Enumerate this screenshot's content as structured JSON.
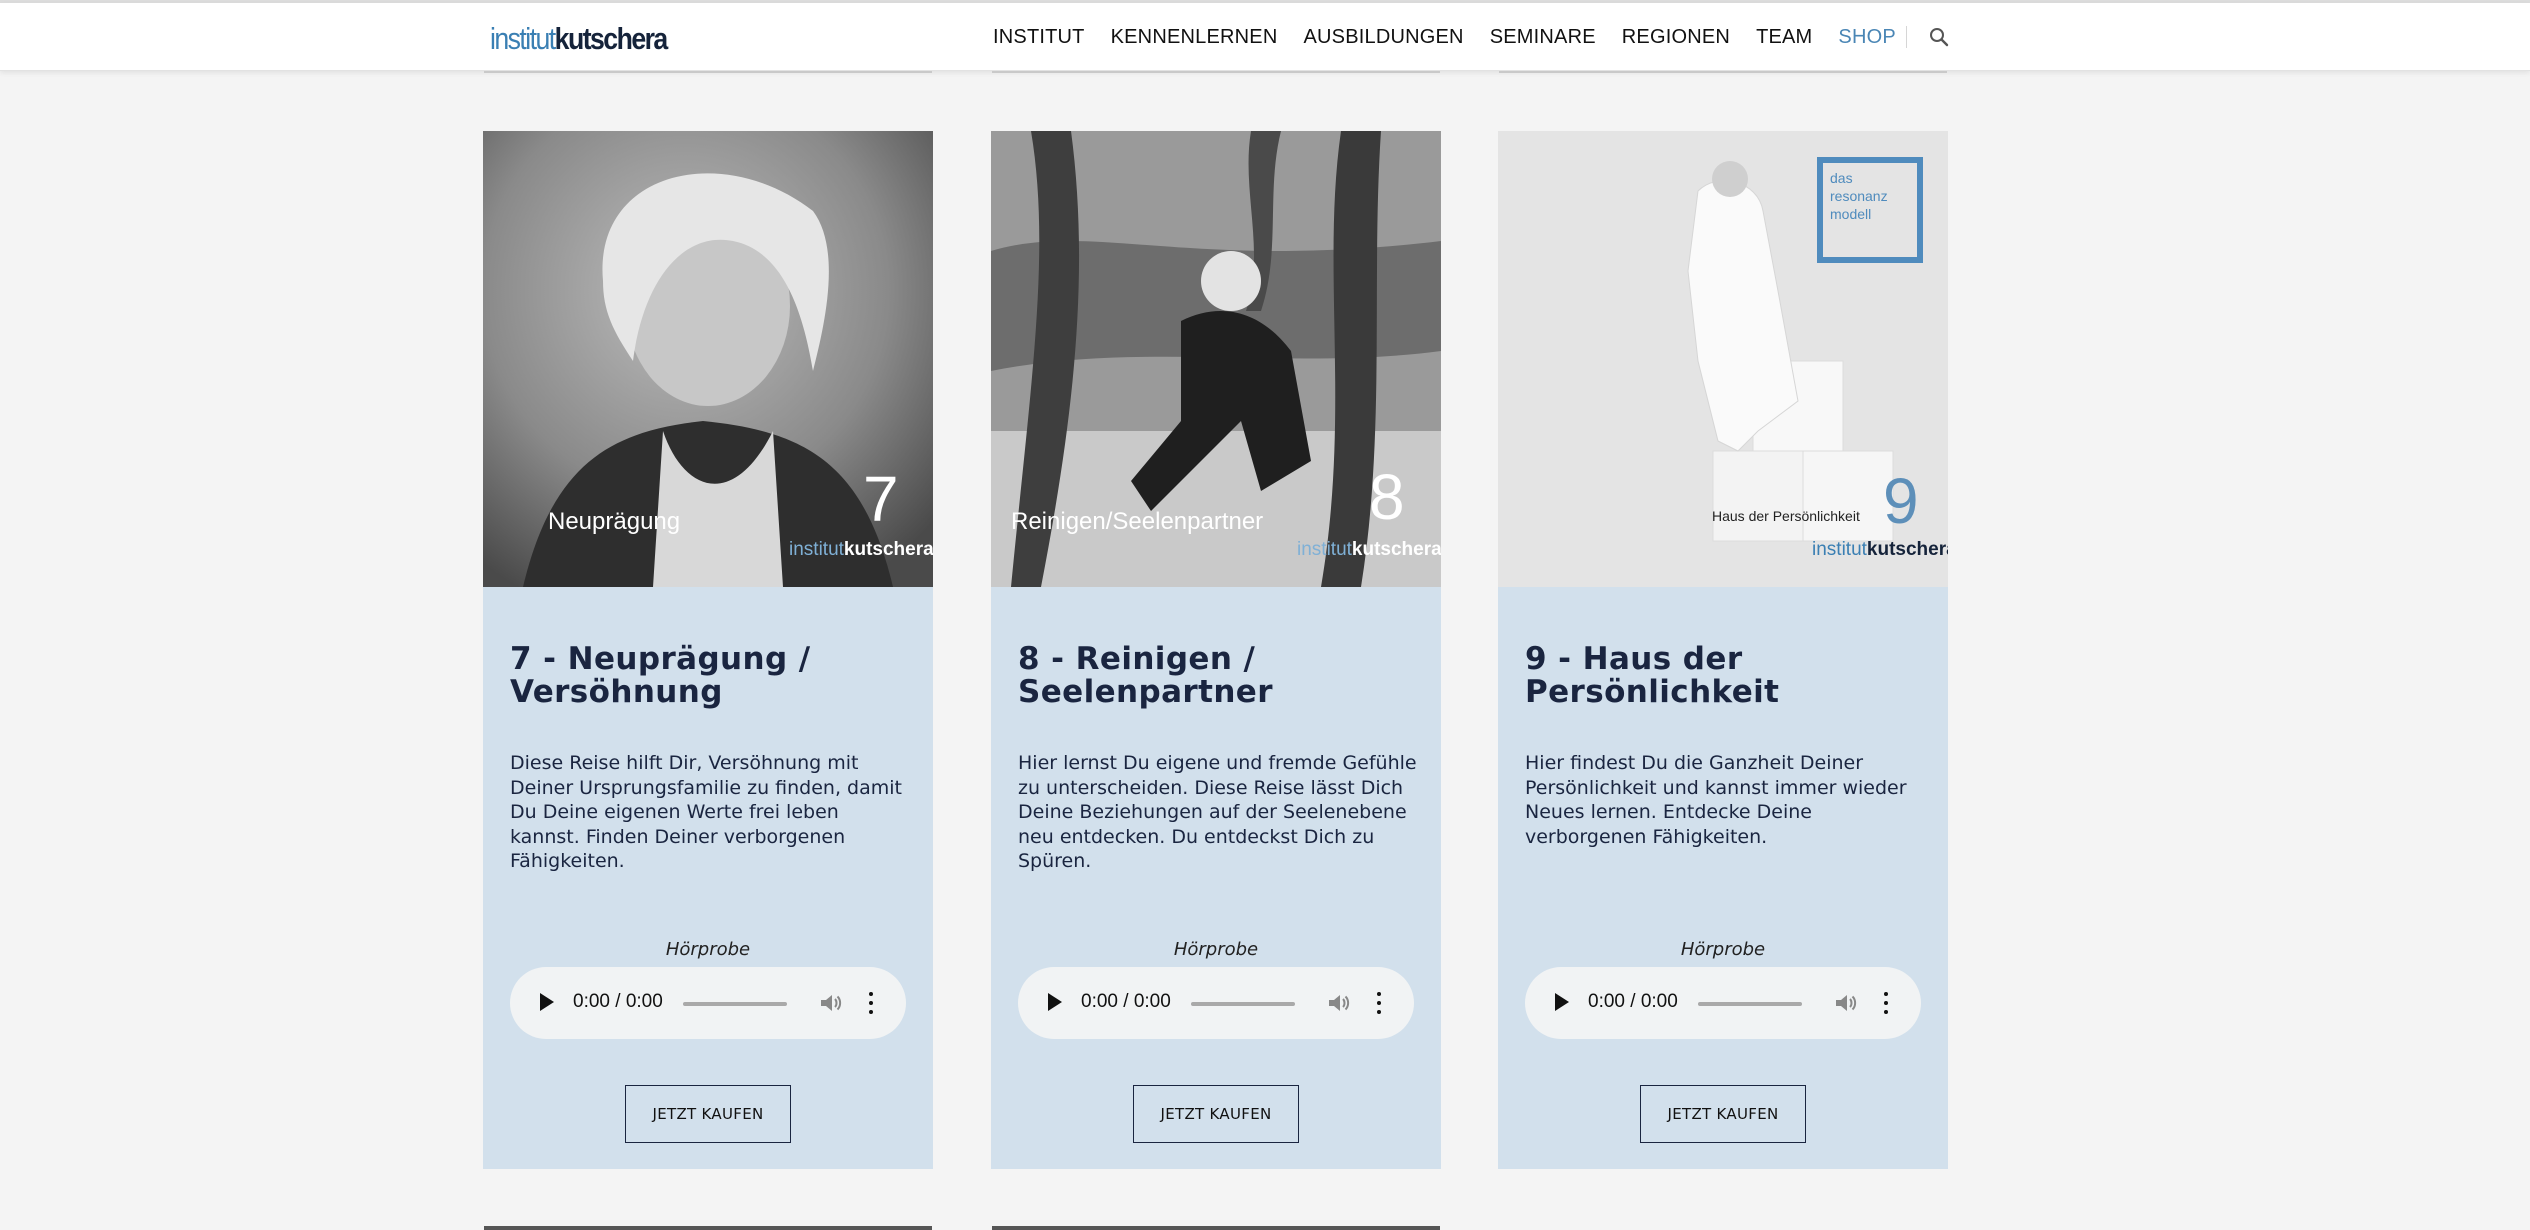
{
  "header": {
    "logo_part1": "institut",
    "logo_part2": "kutschera",
    "nav": [
      "INSTITUT",
      "KENNENLERNEN",
      "AUSBILDUNGEN",
      "SEMINARE",
      "REGIONEN",
      "TEAM",
      "SHOP"
    ],
    "icons": {
      "search": "search-icon"
    }
  },
  "colors": {
    "accent": "#4a86b5",
    "card_bg": "#d2e0ec",
    "page_bg": "#f4f4f4",
    "text": "#1a2540"
  },
  "cards": [
    {
      "title": "7 - Neuprägung / Versöhnung",
      "description": "Diese Reise hilft Dir, Versöhnung mit Deiner Ursprungsfamilie zu finden, damit Du Deine eigenen Werte frei leben kannst. Finden Deiner verborgenen Fähigkeiten.",
      "image_caption": "Neuprägung",
      "image_number": "7",
      "sample_label": "Hörprobe",
      "audio_time": "0:00 / 0:00",
      "button": "JETZT KAUFEN"
    },
    {
      "title": "8 - Reinigen / Seelenpartner",
      "description": "Hier lernst Du eigene und fremde Gefühle zu unterscheiden. Diese Reise lässt Dich Deine Beziehungen auf der Seelenebene neu entdecken. Du entdeckst Dich zu Spüren.",
      "image_caption": "Reinigen/Seelenpartner",
      "image_number": "8",
      "sample_label": "Hörprobe",
      "audio_time": "0:00 / 0:00",
      "button": "JETZT KAUFEN"
    },
    {
      "title": "9 - Haus der Persönlichkeit",
      "description": "Hier findest Du die Ganzheit Deiner Persönlichkeit und kannst immer wieder Neues lernen. Entdecke Deine verborgenen Fähigkeiten.",
      "image_caption": "Haus der Persönlichkeit",
      "image_number": "9",
      "image_badge": "das resonanz modell",
      "sample_label": "Hörprobe",
      "audio_time": "0:00 / 0:00",
      "button": "JETZT KAUFEN"
    }
  ]
}
